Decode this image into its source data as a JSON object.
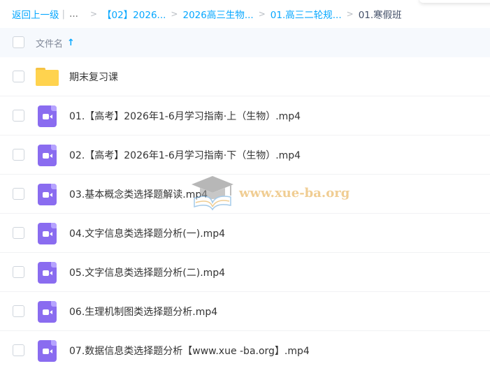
{
  "breadcrumb": {
    "back_label": "返回上一级",
    "separator": "|",
    "ellipsis": "...",
    "crumbs": [
      "【02】2026...",
      "2026高三生物...",
      "01.高三二轮规...",
      "01.寒假班"
    ],
    "chevron": ">"
  },
  "header": {
    "column_label": "文件名",
    "sort_arrow": "↑"
  },
  "files": [
    {
      "name": "期末复习课",
      "type": "folder"
    },
    {
      "name": "01.【高考】2026年1-6月学习指南·上（生物）.mp4",
      "type": "video"
    },
    {
      "name": "02.【高考】2026年1-6月学习指南·下（生物）.mp4",
      "type": "video"
    },
    {
      "name": "03.基本概念类选择题解读.mp4",
      "type": "video"
    },
    {
      "name": "04.文字信息类选择题分析(一).mp4",
      "type": "video"
    },
    {
      "name": "05.文字信息类选择题分析(二).mp4",
      "type": "video"
    },
    {
      "name": "06.生理机制图类选择题分析.mp4",
      "type": "video"
    },
    {
      "name": "07.数据信息类选择题分析【www.xue -ba.org】.mp4",
      "type": "video"
    }
  ],
  "watermark": {
    "text": "www.xue-ba.org",
    "icon": "graduation-cap-icon"
  },
  "colors": {
    "accent": "#06a7ff",
    "folder": "#ffd34e",
    "video": "#8a6cf0",
    "header_bg": "#f6f9fd"
  }
}
